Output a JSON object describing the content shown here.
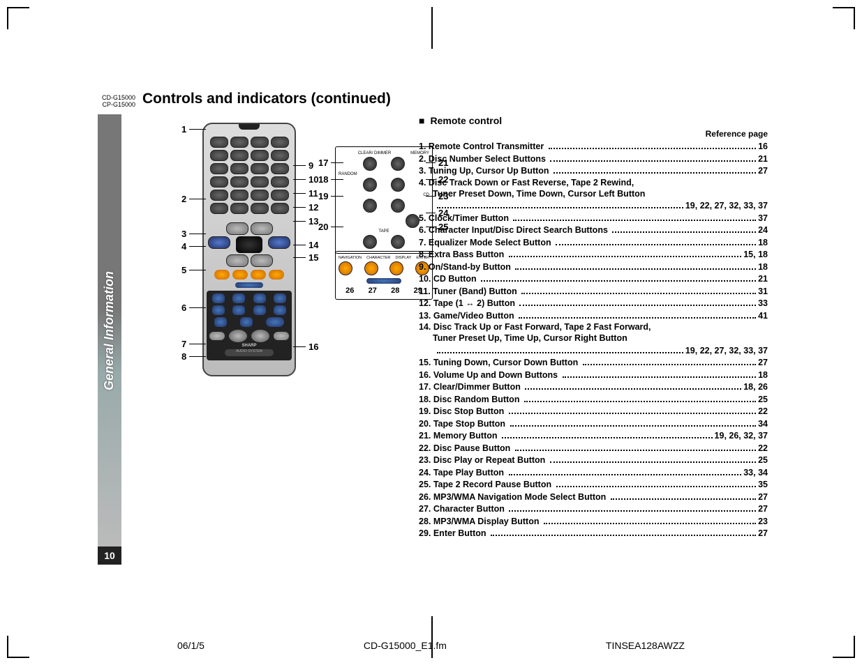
{
  "model_codes": [
    "CD-G15000",
    "CP-G15000"
  ],
  "title": "Controls and indicators (continued)",
  "sidebar_label": "General Information",
  "page_number": "10",
  "section_title": "Remote control",
  "reference_header": "Reference page",
  "diagram": {
    "left_callouts": [
      "1",
      "2",
      "3",
      "4",
      "5",
      "6",
      "7",
      "8"
    ],
    "right_callouts_main": [
      "9",
      "10",
      "11",
      "12",
      "13",
      "14",
      "15",
      "16"
    ],
    "panel_top": {
      "left": [
        "17",
        "18",
        "19",
        "20"
      ],
      "right": [
        "21",
        "22",
        "23",
        "24",
        "25"
      ],
      "labels": [
        "CLEAR/\nDIMMER",
        "MEMORY",
        "RANDOM",
        "CD",
        "TAPE"
      ]
    },
    "panel_bottom": {
      "nums": [
        "26",
        "27",
        "28",
        "29"
      ],
      "labels": [
        "NAVIGATION",
        "CHARACTER",
        "DISPLAY",
        "ENTER"
      ]
    }
  },
  "items": [
    {
      "n": "1.",
      "label": "Remote Control Transmitter",
      "page": "16"
    },
    {
      "n": "2.",
      "label": "Disc Number Select Buttons",
      "page": "21"
    },
    {
      "n": "3.",
      "label": "Tuning Up, Cursor Up Button",
      "page": "27"
    },
    {
      "n": "4.",
      "label": "Disc Track Down or Fast Reverse, Tape 2 Rewind,",
      "cont": "Tuner Preset Down, Time Down, Cursor Left Button",
      "page": "19, 22, 27, 32, 33, 37"
    },
    {
      "n": "5.",
      "label": "Clock/Timer Button",
      "page": "37"
    },
    {
      "n": "6.",
      "label": "Character Input/Disc Direct Search Buttons",
      "page": "24"
    },
    {
      "n": "7.",
      "label": "Equalizer Mode Select Button",
      "page": "18"
    },
    {
      "n": "8.",
      "label": "Extra Bass Button",
      "page": "15, 18"
    },
    {
      "n": "9.",
      "label": "On/Stand-by Button",
      "page": "18"
    },
    {
      "n": "10.",
      "label": "CD Button",
      "page": "21"
    },
    {
      "n": "11.",
      "label": "Tuner (Band) Button",
      "page": "31"
    },
    {
      "n": "12.",
      "label": "Tape (1 ↔ 2) Button",
      "page": "33"
    },
    {
      "n": "13.",
      "label": "Game/Video Button",
      "page": "41"
    },
    {
      "n": "14.",
      "label": "Disc Track Up or Fast Forward, Tape 2 Fast Forward,",
      "cont": "Tuner Preset Up, Time Up, Cursor Right Button",
      "page": "19, 22, 27, 32, 33, 37"
    },
    {
      "n": "15.",
      "label": "Tuning Down, Cursor Down Button",
      "page": "27"
    },
    {
      "n": "16.",
      "label": "Volume Up and Down Buttons",
      "page": "18"
    },
    {
      "n": "17.",
      "label": "Clear/Dimmer Button",
      "page": "18, 26"
    },
    {
      "n": "18.",
      "label": "Disc Random Button",
      "page": "25"
    },
    {
      "n": "19.",
      "label": "Disc Stop Button",
      "page": "22"
    },
    {
      "n": "20.",
      "label": "Tape Stop Button",
      "page": "34"
    },
    {
      "n": "21.",
      "label": "Memory Button",
      "page": "19, 26, 32, 37"
    },
    {
      "n": "22.",
      "label": "Disc Pause Button",
      "page": "22"
    },
    {
      "n": "23.",
      "label": "Disc Play or Repeat Button",
      "page": "25"
    },
    {
      "n": "24.",
      "label": "Tape Play Button",
      "page": "33, 34"
    },
    {
      "n": "25.",
      "label": "Tape 2 Record Pause Button",
      "page": "35"
    },
    {
      "n": "26.",
      "label": "MP3/WMA Navigation Mode Select Button",
      "page": "27"
    },
    {
      "n": "27.",
      "label": "Character Button",
      "page": "27"
    },
    {
      "n": "28.",
      "label": "MP3/WMA Display Button",
      "page": "23"
    },
    {
      "n": "29.",
      "label": "Enter Button",
      "page": "27"
    }
  ],
  "footer": {
    "date": "06/1/5",
    "file": "CD-G15000_E1.fm",
    "code": "TINSEA128AWZZ"
  }
}
